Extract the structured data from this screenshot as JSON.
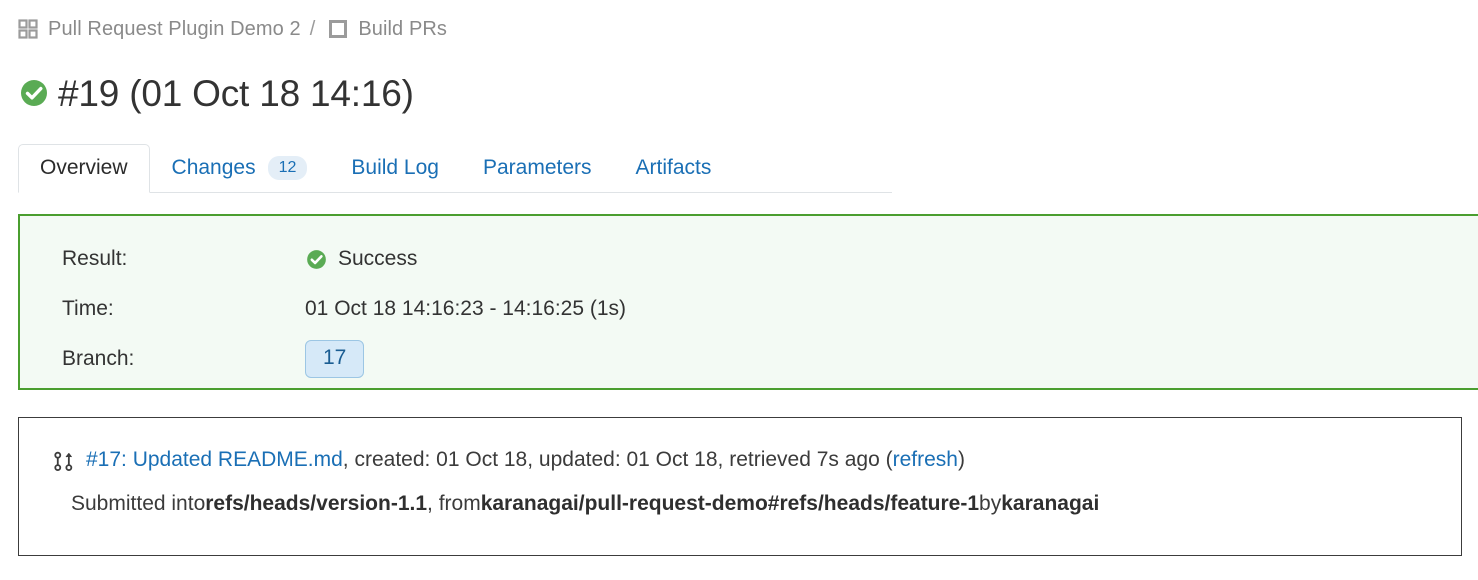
{
  "breadcrumb": {
    "project_icon": "grid-icon",
    "project": "Pull Request Plugin Demo 2",
    "separator": "/",
    "build_icon": "square-icon",
    "build_config": "Build PRs"
  },
  "header": {
    "status_icon": "success-check-icon",
    "title": "#19 (01 Oct 18 14:16)"
  },
  "tabs": [
    {
      "label": "Overview",
      "active": true,
      "badge": null
    },
    {
      "label": "Changes",
      "active": false,
      "badge": "12"
    },
    {
      "label": "Build Log",
      "active": false,
      "badge": null
    },
    {
      "label": "Parameters",
      "active": false,
      "badge": null
    },
    {
      "label": "Artifacts",
      "active": false,
      "badge": null
    }
  ],
  "result_panel": {
    "result_label": "Result:",
    "result_icon": "success-check-icon",
    "result_value": "Success",
    "time_label": "Time:",
    "time_value": "01 Oct 18 14:16:23 - 14:16:25 (1s)",
    "branch_label": "Branch:",
    "branch_value": "17"
  },
  "pull_request": {
    "icon": "git-pull-request-icon",
    "link_text": "#17: Updated README.md",
    "meta_created": ", created: 01 Oct 18, updated: 01 Oct 18, retrieved 7s ago (",
    "refresh_link": "refresh",
    "meta_close": ")",
    "submitted_prefix": "Submitted into ",
    "target_branch": "refs/heads/version-1.1",
    "from_text": ", from ",
    "source_branch": "karanagai/pull-request-demo#refs/heads/feature-1",
    "by_text": " by ",
    "author": "karanagai"
  },
  "colors": {
    "link": "#1a6fb5",
    "success_green": "#4a9e2f",
    "panel_green_bg": "#f3faf4",
    "badge_bg": "#e4eef7",
    "branch_bg": "#d6e9f8",
    "muted_text": "#8a8a8a"
  }
}
